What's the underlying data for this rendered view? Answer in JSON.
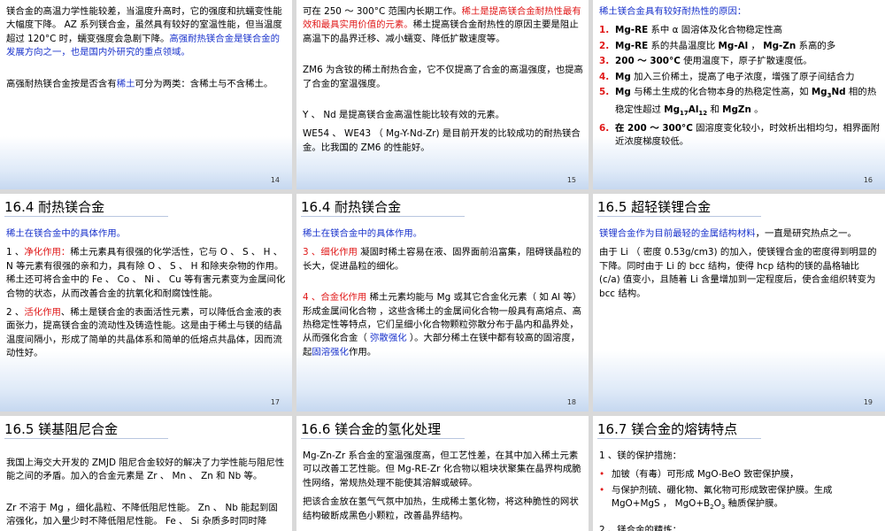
{
  "slides": {
    "s14": {
      "page": "14",
      "p1a": "镁合金的高温力学性能较差，当温度升高时，它的强度和抗蠕变性能大幅度下降。 AZ 系列镁合金，虽然具有较好的室温性能，但当温度超过 120°C 时，蠕变强度会急剧下降。",
      "p1b": "高强耐热镁合金是镁合金的发展方向之一，也是国内外研究的重点领域。",
      "p2a": "高强耐热镁合金按是否含有",
      "p2b": "稀土",
      "p2c": "可分为两类：含稀土与不含稀土。"
    },
    "s15": {
      "page": "15",
      "p1a": "可在 250 ～ 300°C 范围内长期工作。",
      "p1b": "稀土是提高镁合金耐热性最有效和最具实用价值的元素。",
      "p1c": "稀土提高镁合金耐热性的原因主要是阻止高温下的晶界迁移、减小蠕变、降低扩散速度等。",
      "p2": "ZM6 为含钕的稀土耐热合金，它不仅提高了合金的高温强度，也提高了合金的室温强度。",
      "p3": "Y 、 Nd 是提高镁合金高温性能比较有效的元素。",
      "p4": "WE54 、 WE43 （ Mg-Y-Nd-Zr) 是目前开发的比较成功的耐热镁合金。比我国的 ZM6 的性能好。"
    },
    "s16": {
      "page": "16",
      "heading": "稀土镁合金具有较好耐热性的原因：",
      "items": [
        {
          "n": "1.",
          "a": "Mg-RE",
          "b": " 系中 α 固溶体及化合物稳定性高"
        },
        {
          "n": "2.",
          "a": "Mg-RE",
          "b": " 系的共晶温度比 ",
          "c": "Mg-Al",
          "d": " ， ",
          "e": "Mg-Zn",
          "f": " 系高的多"
        },
        {
          "n": "3.",
          "a": "200 ～ 300°C",
          "b": " 使用温度下，原子扩散速度低。"
        },
        {
          "n": "4.",
          "a": "Mg",
          "b": " 加入三价稀土，提高了电子浓度，增强了原子间结合力"
        },
        {
          "n": "5.",
          "a": "Mg",
          "b": " 与稀土生成的化合物本身的热稳定性高，如 ",
          "c": "Mg",
          "c_sub": "3",
          "d": "Nd",
          "e": " 相的热稳定性超过 ",
          "f": "Mg",
          "f_sub": "17",
          "g": "Al",
          "g_sub": "12",
          "h": " 和 ",
          "i": "MgZn",
          "j": " 。"
        },
        {
          "n": "6.",
          "a": "在 200 ～ 300°C",
          "b": " 固溶度变化较小，时效析出相均匀，相界面附近浓度梯度较低。"
        }
      ]
    },
    "s17": {
      "page": "17",
      "title": "16.4 耐热镁合金",
      "heading": "稀土在镁合金中的具体作用。",
      "p1a": "1 、",
      "p1b": "净化作用：",
      "p1c": "稀土元素具有很强的化学活性，它与 O 、 S 、 H 、 N 等元素有很强的亲和力，具有除 O 、 S 、 H 和除夹杂物的作用。稀土还可将合金中的 Fe 、 Co 、 Ni 、 Cu 等有害元素变为金属间化合物的状态，从而改善合金的抗氧化和耐腐蚀性能。",
      "p2a": "2 、",
      "p2b": "活化作用",
      "p2c": "、稀土是镁合金的表面活性元素，可以降低合金液的表面张力，提高镁合金的流动性及铸造性能。这是由于稀土与镁的结晶温度间隔小，形成了简单的共晶体系和简单的低熔点共晶体，因而流动性好。"
    },
    "s18": {
      "page": "18",
      "title": "16.4 耐热镁合金",
      "heading": "稀土在镁合金中的具体作用。",
      "p1a": "3 、",
      "p1b": "细化作用",
      "p1c": "    凝固时稀土容易在液、固界面前沿富集，阻碍镁晶粒的长大，促进晶粒的细化。",
      "p2a": "4 、",
      "p2b": "合金化作用",
      "p2c": "    稀土元素均能与 Mg 或其它合金化元素（ 如 Al 等）形成金属间化合物 ，这些含稀土的金属间化合物一般具有高熔点、高热稳定性等特点，它们呈细小化合物颗粒弥散分布于晶内和晶界处，从而强化合金（ ",
      "p2d": "弥散强化",
      "p2e": " ）。大部分稀土在镁中都有较高的固溶度，起",
      "p2f": "固溶强化",
      "p2g": "作用。"
    },
    "s19": {
      "page": "19",
      "title": "16.5 超轻镁锂合金",
      "p1a": "镁锂合金作为目前最轻的金属结构材料",
      "p1b": "，一直是研究热点之一。",
      "p2": "由于 Li （ 密度 0.53g/cm3) 的加入，使镁锂合金的密度得到明显的下降。同时由于 Li 的 bcc 结构，使得 hcp 结构的镁的晶格轴比 (c/a) 值变小，且随着 Li 含量增加到一定程度后，使合金组织转变为 bcc 结构。"
    },
    "s20": {
      "title": "16.5 镁基阻尼合金",
      "p1": "我国上海交大开发的 ZMJD 阻尼合金较好的解决了力学性能与阻尼性能之间的矛盾。加入的合金元素是 Zr 、 Mn 、 Zn 和 Nb 等。",
      "p2": "Zr 不溶于 Mg ，细化晶粒、不降低阻尼性能。 Zn 、 Nb 能起到固溶强化，加入量少时不降低阻尼性能。 Fe 、 Si 杂质多时同时降"
    },
    "s21": {
      "title": "16.6 镁合金的氢化处理",
      "p1": "Mg-Zn-Zr 系合金的室温强度高，但工艺性差，在其中加入稀土元素可以改善工艺性能。但 Mg-RE-Zr 化合物以粗块状聚集在晶界构成脆性网络，常规热处理不能使其溶解或破碎。",
      "p2": "把该合金放在氢气气氛中加热，生成稀土氢化物，将这种脆性的网状结构破断成黑色小颗粒，改善晶界结构。"
    },
    "s22": {
      "title": "16.7 镁合金的熔铸特点",
      "h1": "1 、镁的保护措施：",
      "b1": "加铍（有毒）可形成 MgO-BeO 致密保护膜，",
      "b2a": "与保护剂硫、硼化物、氟化物可形成致密保护膜。生成 MgO+MgS ， MgO+B",
      "b2sub": "2",
      "b2b": "O",
      "b2sub2": "3",
      "b2c": " 釉质保护膜。",
      "h2": "2 、镁合金的精炼："
    }
  },
  "colors": {
    "accent_blue": "#1a33cc",
    "accent_red": "#e01818"
  },
  "icons": {
    "bullet": "•"
  }
}
